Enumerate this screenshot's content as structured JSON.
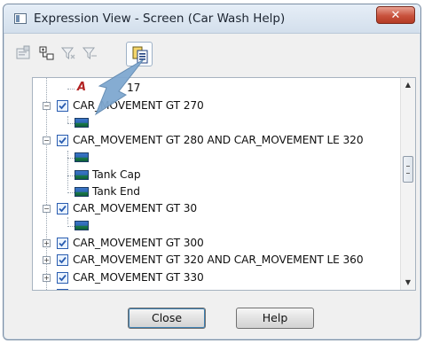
{
  "window": {
    "title": "Expression View - Screen (Car Wash Help)",
    "close_glyph": "✕"
  },
  "toolbar": {
    "icons": [
      "properties-icon",
      "expand-tree-icon",
      "filter-icon",
      "filter-clear-icon",
      "copy-expression-icon"
    ],
    "active": "copy-expression-icon"
  },
  "tree": {
    "rows": [
      {
        "type": "partial",
        "text": "A",
        "suffix": "17"
      },
      {
        "type": "node",
        "text": "CAR_MOVEMENT GT 270",
        "expander": "−"
      },
      {
        "type": "image",
        "text": ""
      },
      {
        "type": "node",
        "text": "CAR_MOVEMENT GT 280 AND CAR_MOVEMENT LE 320",
        "expander": "−"
      },
      {
        "type": "image",
        "text": ""
      },
      {
        "type": "image",
        "text": "Tank Cap"
      },
      {
        "type": "image",
        "text": "Tank End"
      },
      {
        "type": "node",
        "text": "CAR_MOVEMENT GT 30",
        "expander": "−"
      },
      {
        "type": "image",
        "text": ""
      },
      {
        "type": "node",
        "text": "CAR_MOVEMENT GT 300",
        "expander": "+"
      },
      {
        "type": "node",
        "text": "CAR_MOVEMENT GT 320 AND CAR_MOVEMENT LE 360",
        "expander": "+"
      },
      {
        "type": "node",
        "text": "CAR_MOVEMENT GT 330",
        "expander": "+"
      }
    ],
    "scroll_up": "▲",
    "scroll_down": "▼"
  },
  "buttons": {
    "close": "Close",
    "help": "Help"
  },
  "colors": {
    "check": "#2a5db0",
    "title_close": "#c8523d",
    "highlight_arrow": "#7fa8d0"
  }
}
